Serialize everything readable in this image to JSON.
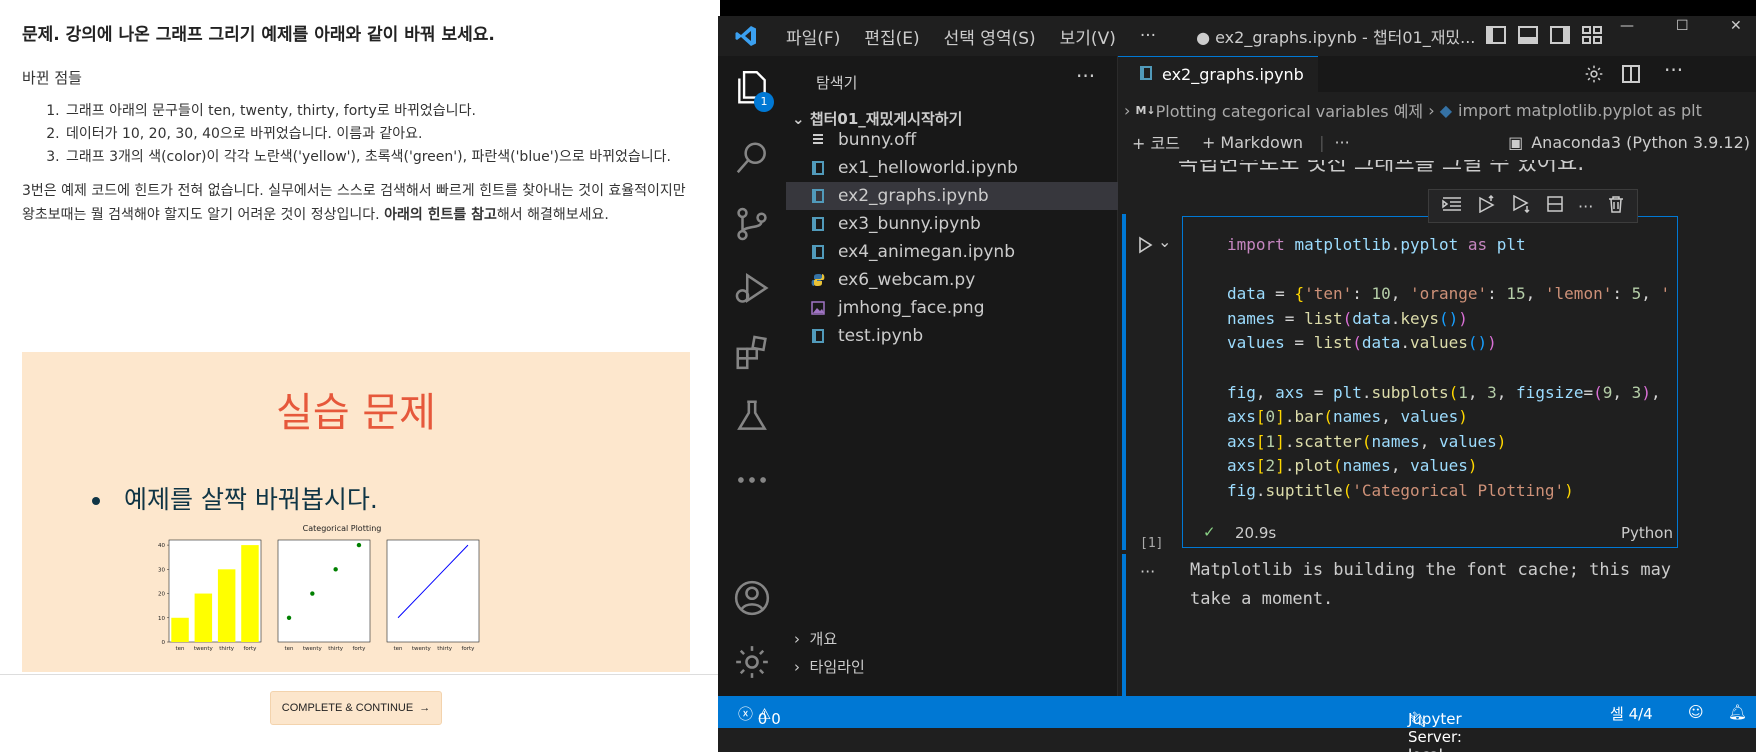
{
  "course": {
    "heading": "문제. 강의에 나온 그래프 그리기 예제를 아래와 같이 바꿔 보세요.",
    "changes_title": "바뀐 점들",
    "changes": [
      "그래프 아래의 문구들이 ten, twenty, thirty, forty로 바뀌었습니다.",
      "데이터가 10, 20, 30, 40으로 바뀌었습니다. 이름과 같아요.",
      "그래프 3개의 색(color)이 각각 노란색('yellow'), 초록색('green'), 파란색('blue')으로 바뀌었습니다."
    ],
    "para_1": "3번은 예제 코드에 힌트가 전혀 없습니다. 실무에서는 스스로 검색해서 빠르게 힌트를 찾아내는 것이 효율적이지만 왕초보때는 뭘 검색해야 할지도 알기 어려운 것이 정상입니다. ",
    "para_bold": "아래의 힌트를 참고",
    "para_2": "해서 해결해보세요.",
    "practice_title": "실습 문제",
    "practice_bullet": "예제를 살짝 바꿔봅시다.",
    "complete_button": "COMPLETE & CONTINUE"
  },
  "chart_data": {
    "type": "bar",
    "title": "Categorical Plotting",
    "categories": [
      "ten",
      "twenty",
      "thirty",
      "forty"
    ],
    "values": [
      10,
      20,
      30,
      40
    ],
    "ylim": [
      0,
      40
    ],
    "yticks": [
      "0",
      "10",
      "20",
      "30",
      "40"
    ],
    "subplots": [
      {
        "kind": "bar",
        "color": "#ffff00"
      },
      {
        "kind": "scatter",
        "color": "#008000"
      },
      {
        "kind": "line",
        "color": "#0000ff"
      }
    ]
  },
  "vscode": {
    "menus": [
      "파일(F)",
      "편집(E)",
      "선택 영역(S)",
      "보기(V)",
      "···"
    ],
    "window_title": "● ex2_graphs.ipynb - 챕터01_재밌...",
    "explorer_title": "탐색기",
    "explorer_badge": "1",
    "folder_name": "챕터01_재밌게시작하기",
    "files": [
      "bunny.off",
      "ex1_helloworld.ipynb",
      "ex2_graphs.ipynb",
      "ex3_bunny.ipynb",
      "ex4_animegan.ipynb",
      "ex6_webcam.py",
      "jmhong_face.png",
      "test.ipynb"
    ],
    "outline_label": "개요",
    "timeline_label": "타임라인",
    "tab_label": "ex2_graphs.ipynb",
    "breadcrumb": {
      "md_icon": "M↓",
      "part1": "Plotting categorical variables 예제",
      "part2": "import matplotlib.pyplot as plt"
    },
    "toolbar": {
      "code_label": "+ 코드",
      "markdown_label": "+ Markdown",
      "more": "···"
    },
    "kernel": "Anaconda3 (Python 3.9.12)",
    "partial_markdown": "독립변수로도 멋진 그래프를 그릴 수 있어요.",
    "exec_count": "[1]",
    "duration": "20.9s",
    "language": "Python",
    "output_text": "Matplotlib is building the font cache; this may\ntake a moment.",
    "output_more": "···",
    "status": {
      "errors": "0",
      "warnings": "0",
      "jupyter": "Jupyter Server: local",
      "cell": "셀 4/4"
    }
  }
}
